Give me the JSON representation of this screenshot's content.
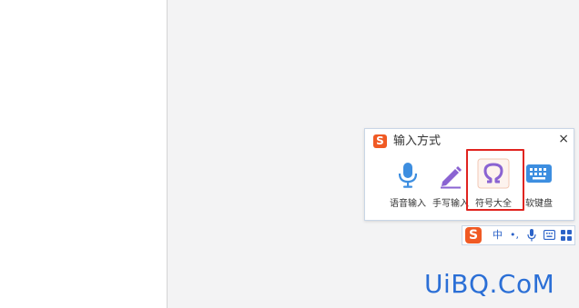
{
  "popup": {
    "title": "输入方式",
    "close_glyph": "×",
    "tools": [
      {
        "label": "语音输入",
        "icon": "microphone-icon"
      },
      {
        "label": "手写输入",
        "icon": "pen-icon"
      },
      {
        "label": "符号大全",
        "icon": "omega-icon"
      },
      {
        "label": "软键盘",
        "icon": "keyboard-icon"
      }
    ]
  },
  "statusbar": {
    "mode": "中",
    "punct": "•,",
    "items": [
      "microphone-icon",
      "keyboard-icon",
      "grid-icon"
    ]
  },
  "logo_letter": "S",
  "watermark": "UiBQ.CoM",
  "colors": {
    "accent_red": "#e02420",
    "brand_orange": "#f05a24",
    "icon_blue": "#3d8ee0",
    "icon_purple": "#8a63d2",
    "watermark_blue": "#2b6fd6"
  }
}
